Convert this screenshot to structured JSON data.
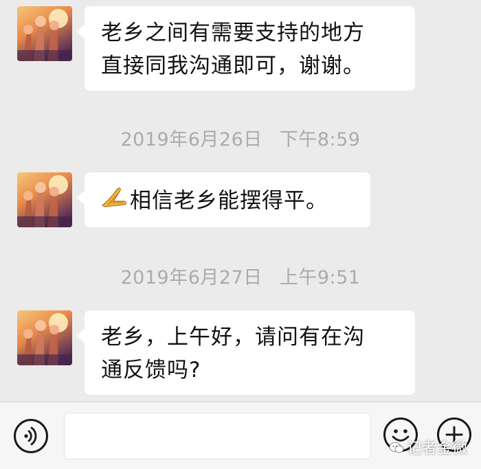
{
  "messages": [
    {
      "lines": [
        "老乡之间有需要支持的地方",
        "直接同我沟通即可，谢谢。"
      ]
    },
    {
      "prefix_icon": "folded-hands-emoji",
      "lines": [
        "相信老乡能摆得平。"
      ]
    },
    {
      "lines": [
        "老乡，上午好，请问有在沟",
        "通反馈吗?"
      ]
    }
  ],
  "timestamps": [
    {
      "date": "2019年6月26日",
      "time": "下午8:59"
    },
    {
      "date": "2019年6月27日",
      "time": "上午9:51"
    }
  ],
  "input_bar": {
    "placeholder": "",
    "left_icon": "voice-icon",
    "right_icons": [
      "emoji-icon",
      "plus-icon"
    ]
  },
  "watermark": {
    "text": "记者金微",
    "icon": "wechat-logo-icon"
  },
  "colors": {
    "chat_background": "#ebebeb",
    "bubble": "#ffffff",
    "timestamp_text": "#ababab",
    "input_bar": "#f6f6f6"
  }
}
